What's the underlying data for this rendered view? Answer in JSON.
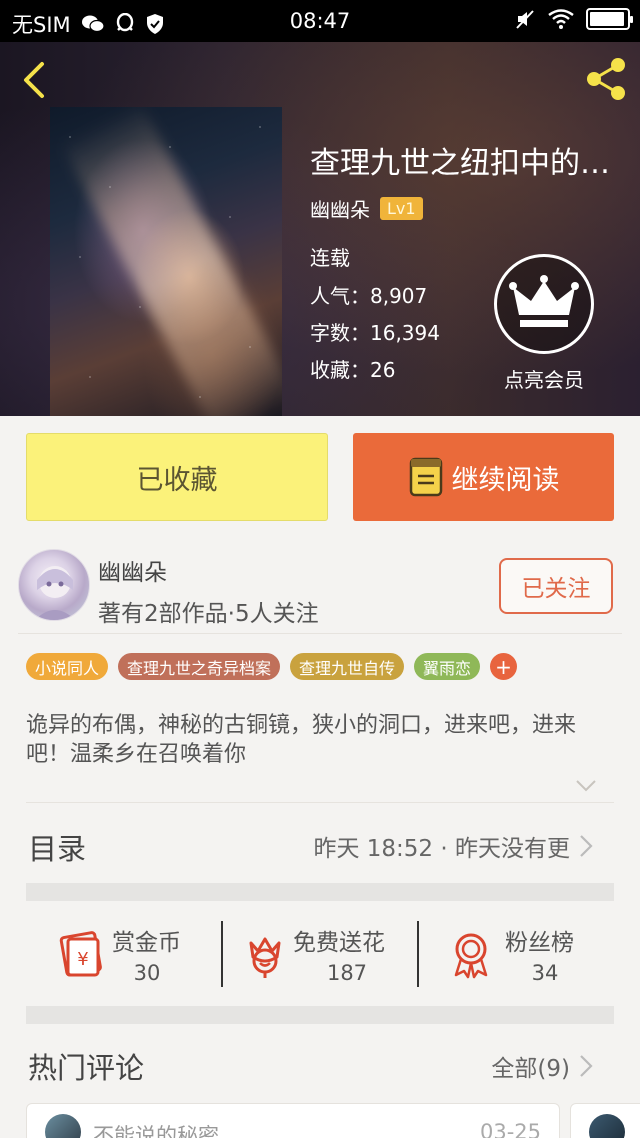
{
  "status_bar": {
    "carrier": "无SIM",
    "time": "08:47",
    "battery_level": 0.95
  },
  "book": {
    "title": "查理九世之纽扣中的…",
    "author": "幽幽朵",
    "level": "Lv1",
    "status": "连载",
    "popularity": "人气：8,907",
    "word_count": "字数：16,394",
    "favorites": "收藏：26"
  },
  "vip": {
    "label": "点亮会员"
  },
  "actions": {
    "collected_label": "已收藏",
    "read_label": "继续阅读"
  },
  "author_card": {
    "name": "幽幽朵",
    "stats": "著有2部作品·5人关注",
    "follow_label": "已关注"
  },
  "tags": [
    {
      "label": "小说同人",
      "color": "#f0a93a"
    },
    {
      "label": "查理九世之奇异档案",
      "color": "#c0705a"
    },
    {
      "label": "查理九世自传",
      "color": "#c9a23e"
    },
    {
      "label": "翼雨恋",
      "color": "#8fb858"
    }
  ],
  "tag_add_symbol": "+",
  "synopsis": "诡异的布偶，神秘的古铜镜，狭小的洞口，进来吧，进来吧！温柔乡在召唤着你",
  "toc": {
    "label": "目录",
    "update_text": "昨天 18:52 · 昨天没有更"
  },
  "stats": [
    {
      "label": "赏金币",
      "value": "30",
      "icon": "red-envelope-icon"
    },
    {
      "label": "免费送花",
      "value": "187",
      "icon": "flower-icon"
    },
    {
      "label": "粉丝榜",
      "value": "34",
      "icon": "medal-icon"
    }
  ],
  "hot_comments": {
    "label": "热门评论",
    "all_label": "全部(9)",
    "items": [
      {
        "name": "不能说的秘密",
        "date": "03-25"
      }
    ]
  },
  "colors": {
    "accent_orange": "#ea6a3a",
    "collected_yellow": "#fbf27a",
    "icon_red": "#d9452e",
    "lv_badge": "#f0b43a"
  }
}
